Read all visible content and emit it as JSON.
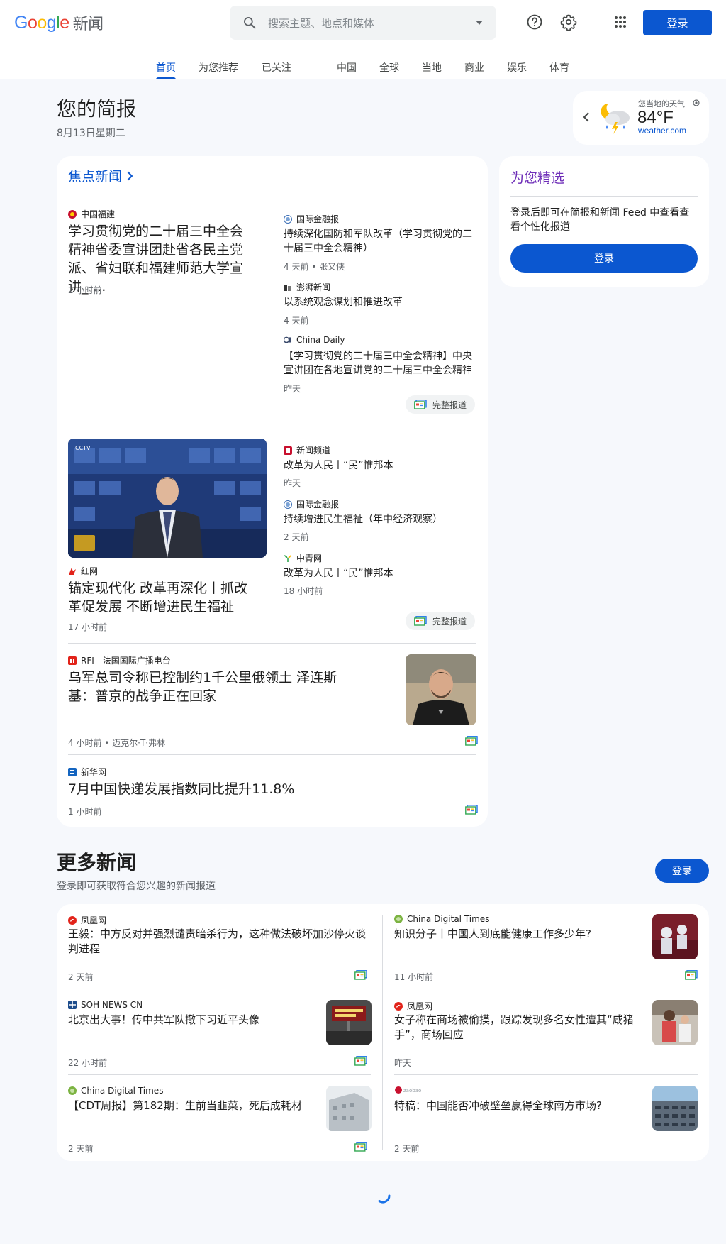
{
  "header": {
    "logo_google": "Google",
    "logo_news": "新闻",
    "search_placeholder": "搜索主题、地点和媒体",
    "signin": "登录",
    "icons": [
      "search-icon",
      "help-icon",
      "settings-icon",
      "apps-grid-icon"
    ]
  },
  "tabs": [
    "首页",
    "为您推荐",
    "已关注",
    "中国",
    "全球",
    "当地",
    "商业",
    "娱乐",
    "体育"
  ],
  "briefing": {
    "title": "您的简报",
    "date": "8月13日星期二"
  },
  "weather": {
    "label": "您当地的天气",
    "temp": "84°F",
    "source": "weather.com"
  },
  "top_stories": {
    "title": "焦点新闻",
    "full_coverage": "完整报道",
    "cluster1": {
      "main": {
        "source": "中国福建",
        "headline": "学习贯彻党的二十届三中全会精神省委宣讲团赴省各民主党派、省妇联和福建师范大学宣讲_ …",
        "time": "2 小时前"
      },
      "side": [
        {
          "source": "国际金融报",
          "headline": "持续深化国防和军队改革（学习贯彻党的二十届三中全会精神）",
          "meta": "4 天前 • 张又侠"
        },
        {
          "source": "澎湃新闻",
          "headline": "以系统观念谋划和推进改革",
          "meta": "4 天前"
        },
        {
          "source": "China Daily",
          "headline": "【学习贯彻党的二十届三中全会精神】中央宣讲团在各地宣讲党的二十届三中全会精神",
          "meta": "昨天"
        }
      ]
    },
    "cluster2": {
      "main": {
        "source": "红网",
        "headline": "锚定现代化 改革再深化丨抓改革促发展 不断增进民生福祉",
        "time": "17 小时前"
      },
      "side": [
        {
          "source": "新闻频道",
          "headline": "改革为人民丨“民”惟邦本",
          "meta": "昨天"
        },
        {
          "source": "国际金融报",
          "headline": "持续增进民生福祉（年中经济观察）",
          "meta": "2 天前"
        },
        {
          "source": "中青网",
          "headline": "改革为人民丨“民”惟邦本",
          "meta": "18 小时前"
        }
      ]
    },
    "story3": {
      "source": "RFI - 法国国际广播电台",
      "headline": "乌军总司令称已控制约1千公里俄领土 泽连斯基：普京的战争正在回家",
      "meta": "4 小时前 • 迈克尔·T·弗林"
    },
    "story4": {
      "source": "新华网",
      "headline": "7月中国快递发展指数同比提升11.8%",
      "meta": "1 小时前"
    }
  },
  "picks": {
    "title": "为您精选",
    "text": "登录后即可在简报和新闻 Feed 中查看查看个性化报道",
    "button": "登录"
  },
  "more": {
    "title": "更多新闻",
    "subtitle": "登录即可获取符合您兴趣的新闻报道",
    "button": "登录",
    "items": [
      {
        "source": "凤凰网",
        "headline": "王毅：中方反对并强烈谴责暗杀行为，这种做法破坏加沙停火谈判进程",
        "time": "2 天前"
      },
      {
        "source": "China Digital Times",
        "headline": "知识分子丨中国人到底能健康工作多少年?",
        "time": "11 小时前"
      },
      {
        "source": "SOH NEWS CN",
        "headline": "北京出大事！传中共军队撤下习近平头像",
        "time": "22 小时前"
      },
      {
        "source": "凤凰网",
        "headline": "女子称在商场被偷摸，跟踪发现多名女性遭其“咸猪手”，商场回应",
        "time": "昨天"
      },
      {
        "source": "China Digital Times",
        "headline": "【CDT周报】第182期：生前当韭菜，死后成耗材",
        "time": "2 天前"
      },
      {
        "source": "zaobao",
        "headline": "特稿：中国能否冲破壁垒赢得全球南方市场?",
        "time": "2 天前"
      }
    ]
  },
  "colors": {
    "accent": "#0b57d0",
    "picks_title": "#6f2fb8",
    "background": "#f6f8fc"
  }
}
